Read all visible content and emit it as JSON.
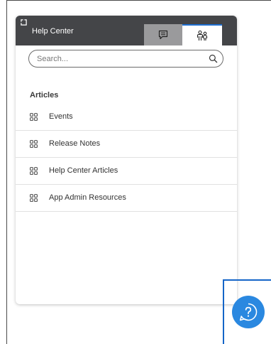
{
  "header": {
    "title": "Help Center",
    "icons": {
      "popout": "popout-icon",
      "chat_tab": "chat-bubble-icon",
      "people_tab": "people-icon"
    }
  },
  "search": {
    "placeholder": "Search...",
    "value": "",
    "icon": "search-icon"
  },
  "articles": {
    "heading": "Articles",
    "items": [
      {
        "label": "Events",
        "icon": "grid-icon"
      },
      {
        "label": "Release Notes",
        "icon": "grid-icon"
      },
      {
        "label": "Help Center Articles",
        "icon": "grid-icon"
      },
      {
        "label": "App Admin Resources",
        "icon": "grid-icon"
      }
    ]
  },
  "launcher": {
    "icon": "help-question-bubble-icon"
  },
  "colors": {
    "header_bg": "#444548",
    "active_tab_accent": "#1f6fd1",
    "inactive_tab_bg": "#9a9a9c",
    "launcher_bg": "#2a88e0",
    "launcher_frame": "#1565c8"
  }
}
